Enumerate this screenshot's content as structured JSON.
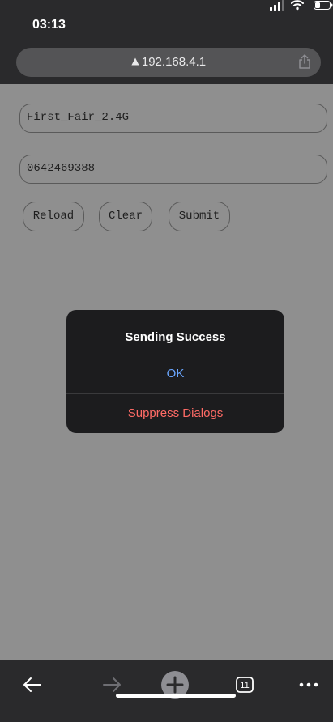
{
  "status_bar": {
    "time": "03:13"
  },
  "address_bar": {
    "url": "192.168.4.1"
  },
  "form": {
    "ssid_value": "First_Fair_2.4G",
    "password_value": "0642469388",
    "buttons": {
      "reload": "Reload",
      "clear": "Clear",
      "submit": "Submit"
    }
  },
  "dialog": {
    "title": "Sending Success",
    "ok_label": "OK",
    "suppress_label": "Suppress Dialogs"
  },
  "toolbar": {
    "tab_count": "11"
  },
  "colors": {
    "page_background": "#8f8f8f",
    "chrome_background": "#2a2a2c",
    "dialog_background": "#1c1c1e",
    "ok_text": "#6aa6ff",
    "suppress_text": "#ff6b66"
  }
}
